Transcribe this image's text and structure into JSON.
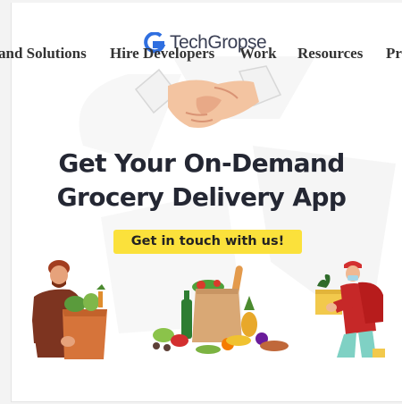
{
  "brand": {
    "name": "TechGropse"
  },
  "nav": {
    "items": [
      {
        "label": "and Solutions"
      },
      {
        "label": "Hire Developers"
      },
      {
        "label": "Work"
      },
      {
        "label": "Resources"
      },
      {
        "label": "Pr"
      }
    ]
  },
  "hero": {
    "headline_line1": "Get Your On-Demand",
    "headline_line2": "Grocery Delivery App",
    "cta_label": "Get in touch with us!"
  },
  "colors": {
    "cta_background": "#fbe13b",
    "headline": "#242733",
    "nav_text": "#333333",
    "logo_accent": "#2f6fe0"
  },
  "icons": [
    "techgropse-logo-icon",
    "handshake-icon",
    "shopper-man-illustration",
    "grocery-bag-illustration",
    "delivery-woman-illustration"
  ]
}
